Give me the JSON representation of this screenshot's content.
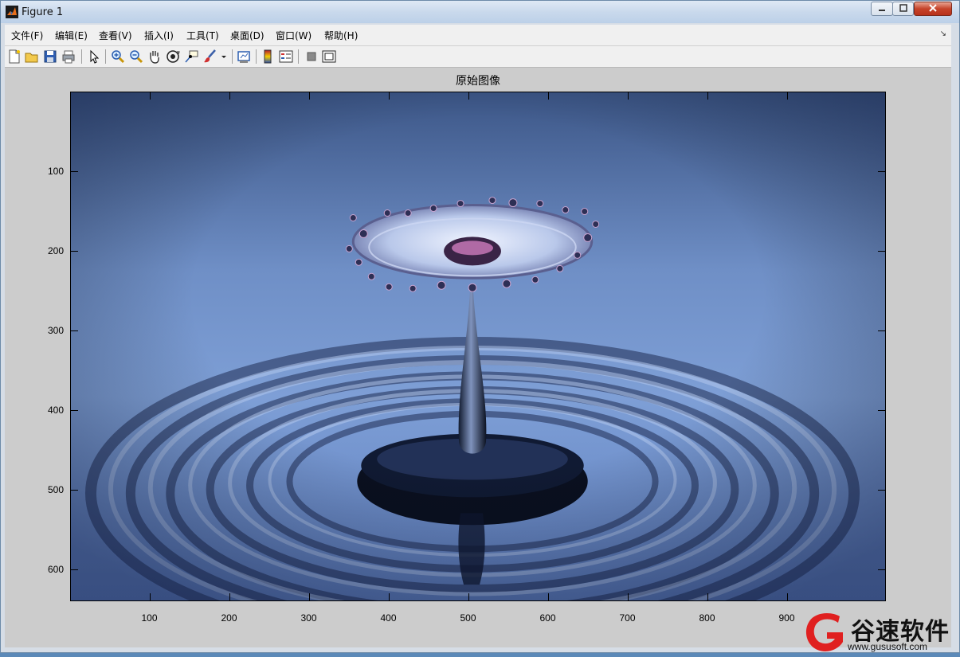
{
  "window": {
    "title": "Figure 1"
  },
  "menu": [
    {
      "label": "文件(F)"
    },
    {
      "label": "编辑(E)"
    },
    {
      "label": "查看(V)"
    },
    {
      "label": "插入(I)"
    },
    {
      "label": "工具(T)"
    },
    {
      "label": "桌面(D)"
    },
    {
      "label": "窗口(W)"
    },
    {
      "label": "帮助(H)"
    }
  ],
  "toolbar": [
    {
      "icon": "new-figure-icon"
    },
    {
      "icon": "open-file-icon"
    },
    {
      "icon": "save-icon"
    },
    {
      "icon": "print-icon"
    },
    {
      "icon": "pointer-icon"
    },
    {
      "icon": "zoom-in-icon"
    },
    {
      "icon": "zoom-out-icon"
    },
    {
      "icon": "pan-icon"
    },
    {
      "icon": "rotate-3d-icon"
    },
    {
      "icon": "data-cursor-icon"
    },
    {
      "icon": "brush-icon"
    },
    {
      "icon": "link-plot-icon"
    },
    {
      "icon": "colorbar-icon"
    },
    {
      "icon": "legend-icon"
    },
    {
      "icon": "hide-plot-tools-icon"
    },
    {
      "icon": "show-plot-tools-icon"
    }
  ],
  "axes": {
    "title": "原始图像",
    "xticks": [
      "100",
      "200",
      "300",
      "400",
      "500",
      "600",
      "700",
      "800",
      "900"
    ],
    "yticks": [
      "100",
      "200",
      "300",
      "400",
      "500",
      "600"
    ],
    "xlim": [
      0.5,
      1024.5
    ],
    "ylim": [
      0.5,
      640.5
    ]
  },
  "watermark": {
    "text": "谷速软件",
    "url": "www.gususoft.com"
  }
}
